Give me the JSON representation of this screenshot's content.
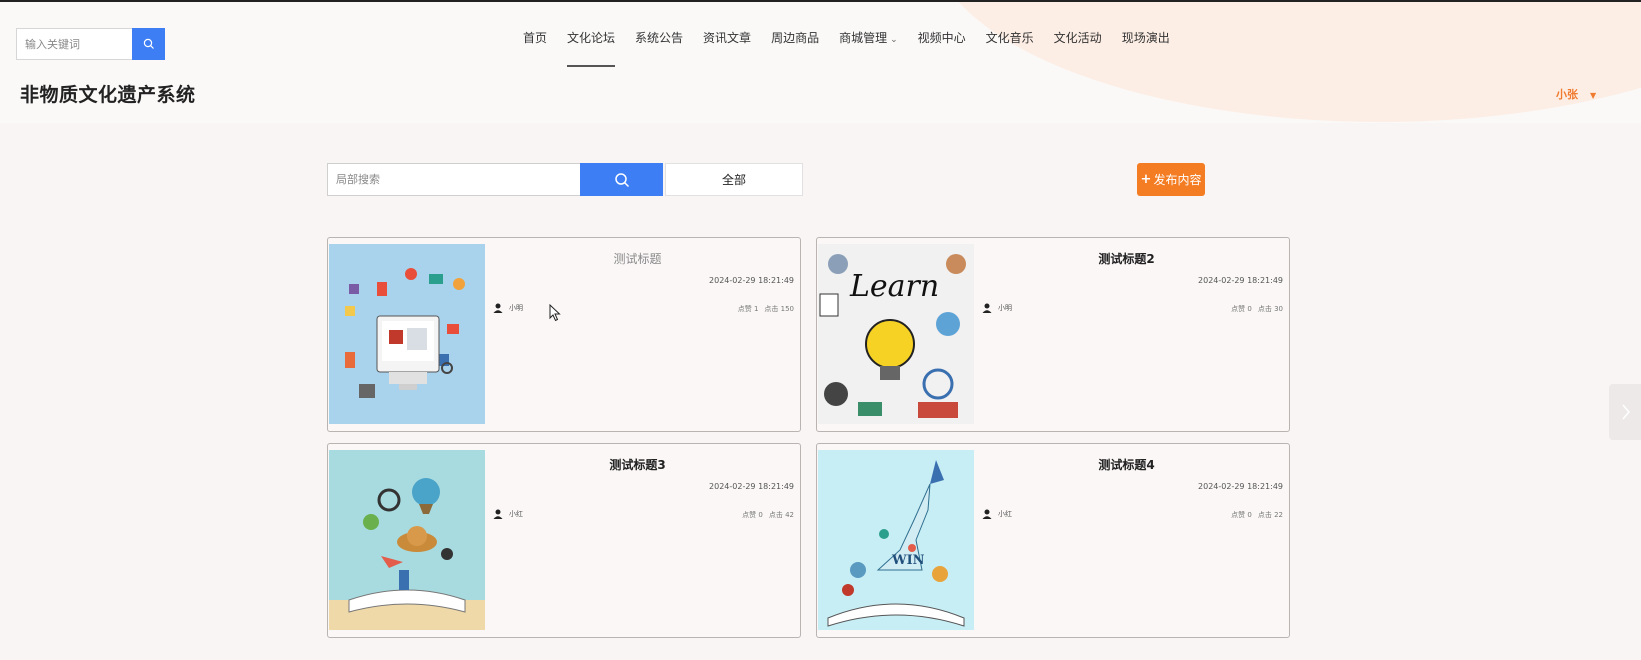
{
  "header": {
    "search_placeholder": "输入关键词",
    "site_title": "非物质文化遗产系统",
    "nav": [
      {
        "label": "首页"
      },
      {
        "label": "文化论坛"
      },
      {
        "label": "系统公告"
      },
      {
        "label": "资讯文章"
      },
      {
        "label": "周边商品"
      },
      {
        "label": "商城管理"
      },
      {
        "label": "视频中心"
      },
      {
        "label": "文化音乐"
      },
      {
        "label": "文化活动"
      },
      {
        "label": "现场演出"
      }
    ],
    "active_nav": "文化论坛",
    "user_name": "小张"
  },
  "toolbar": {
    "local_search_placeholder": "局部搜索",
    "filter_label": "全部",
    "publish_label": "发布内容"
  },
  "posts": [
    {
      "title": "测试标题",
      "date": "2024-02-29 18:21:49",
      "author": "小明",
      "likes": "点赞 1",
      "clicks": "点击 150"
    },
    {
      "title": "测试标题2",
      "date": "2024-02-29 18:21:49",
      "author": "小明",
      "likes": "点赞 0",
      "clicks": "点击 30"
    },
    {
      "title": "测试标题3",
      "date": "2024-02-29 18:21:49",
      "author": "小红",
      "likes": "点赞 0",
      "clicks": "点击 42"
    },
    {
      "title": "测试标题4",
      "date": "2024-02-29 18:21:49",
      "author": "小红",
      "likes": "点赞 0",
      "clicks": "点击 22"
    }
  ],
  "thumb_words": {
    "learn": "Learn",
    "win": "WIN"
  },
  "icons": {
    "search": "search-icon",
    "user": "user-icon",
    "next": "chevron-right-icon",
    "plus": "plus-icon",
    "caret": "chevron-down-icon"
  },
  "colors": {
    "accent": "#3d7ef5",
    "publish": "#f47c22",
    "user_name": "#f07a2e"
  }
}
